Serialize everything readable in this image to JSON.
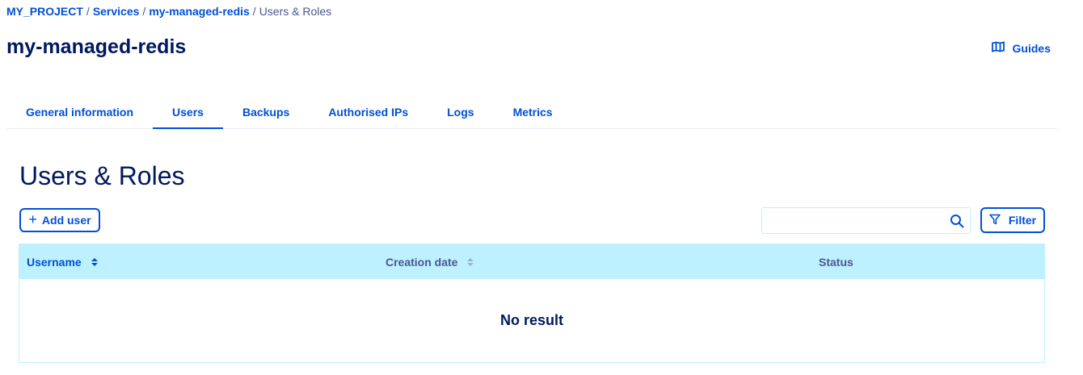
{
  "breadcrumb": {
    "project": "MY_PROJECT",
    "services": "Services",
    "service": "my-managed-redis",
    "current": "Users & Roles",
    "separator": "/"
  },
  "header": {
    "title": "my-managed-redis",
    "guides_label": "Guides"
  },
  "tabs": [
    {
      "label": "General information"
    },
    {
      "label": "Users",
      "active": true
    },
    {
      "label": "Backups"
    },
    {
      "label": "Authorised IPs"
    },
    {
      "label": "Logs"
    },
    {
      "label": "Metrics"
    }
  ],
  "main": {
    "section_title": "Users & Roles",
    "add_user_label": "Add user",
    "search": {
      "value": "",
      "placeholder": ""
    },
    "filter_label": "Filter",
    "table": {
      "columns": [
        "Username",
        "Creation date",
        "Status"
      ],
      "empty_text": "No result"
    }
  },
  "colors": {
    "primary": "#0050d7",
    "text": "#00185e",
    "table_header_bg": "#bef1ff"
  }
}
